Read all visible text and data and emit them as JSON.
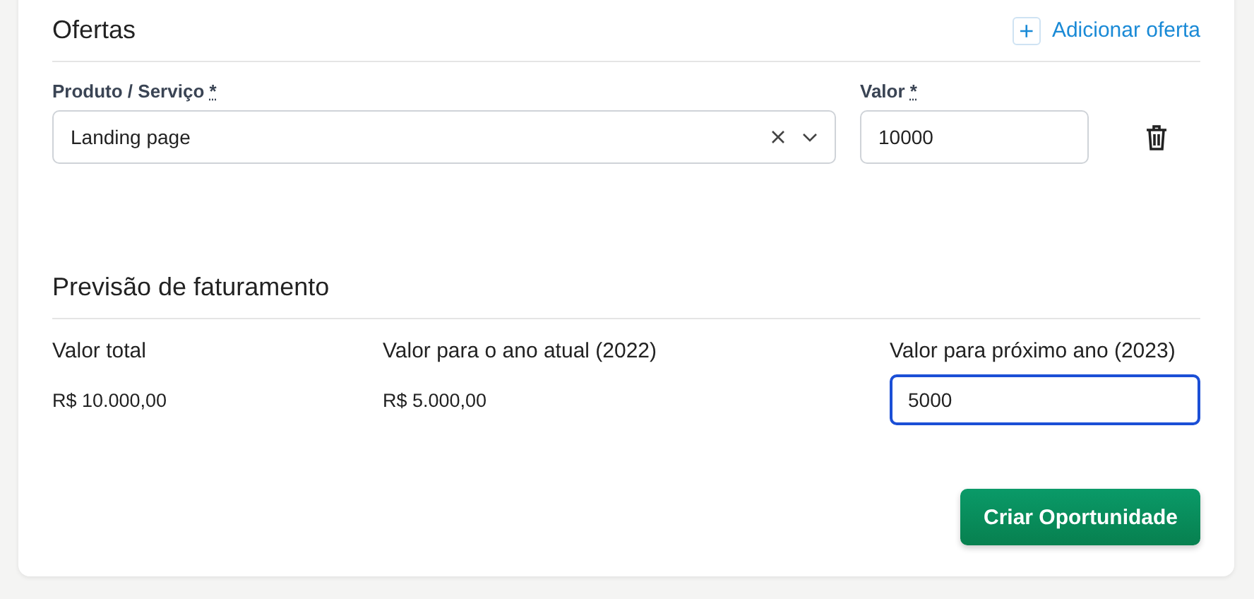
{
  "offers_section": {
    "title": "Ofertas",
    "add_button": {
      "icon": "+",
      "label": "Adicionar oferta"
    }
  },
  "offers": [
    {
      "product": {
        "label": "Produto / Serviço",
        "required_mark": "*",
        "value": "Landing page"
      },
      "value": {
        "label": "Valor",
        "required_mark": "*",
        "value": "10000"
      }
    }
  ],
  "forecast_section": {
    "title": "Previsão de faturamento"
  },
  "forecast": [
    {
      "kind": "text",
      "label": "Valor total",
      "value": "R$ 10.000,00"
    },
    {
      "kind": "text",
      "label": "Valor para o ano atual (2022)",
      "value": "R$ 5.000,00"
    },
    {
      "kind": "input",
      "label": "Valor para próximo ano (2023)",
      "value": "5000",
      "focused": true
    }
  ],
  "submit_button": "Criar Oportunidade"
}
